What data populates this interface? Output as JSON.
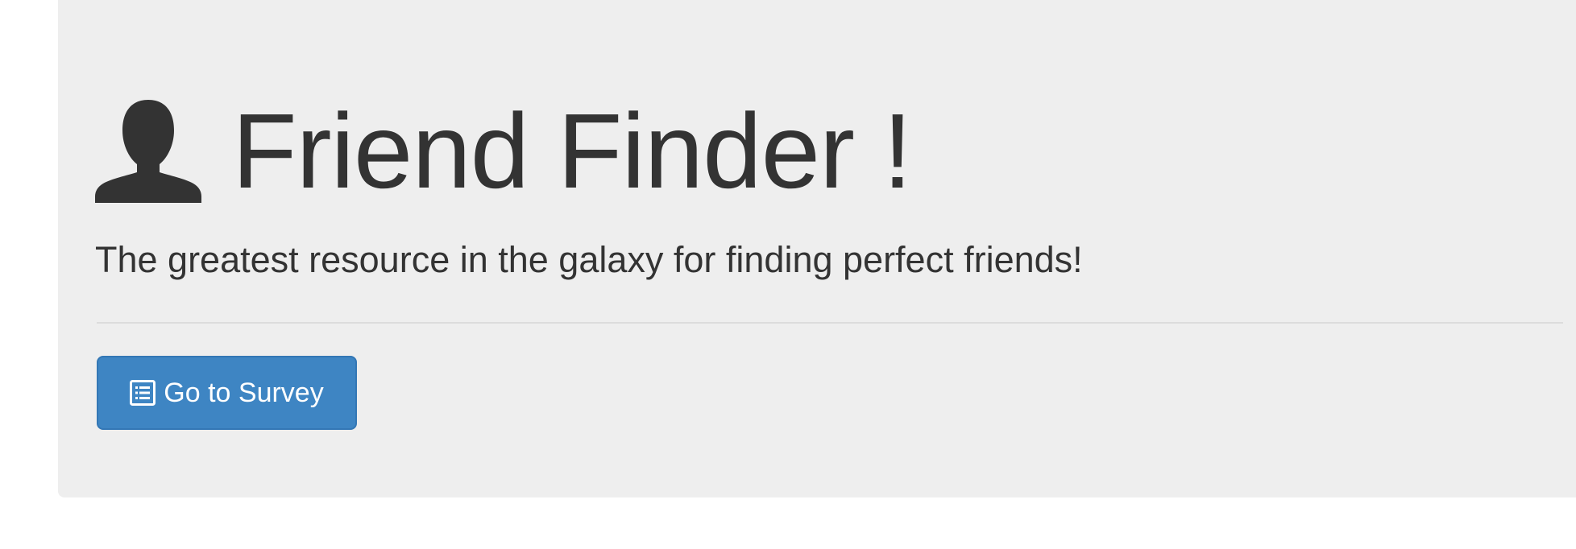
{
  "header": {
    "title": "Friend Finder !",
    "icon": "user-icon",
    "subtitle": "The greatest resource in the galaxy for finding perfect friends!"
  },
  "actions": {
    "survey_button": {
      "label": "Go to Survey",
      "icon": "list-alt-icon"
    }
  },
  "colors": {
    "jumbotron_bg": "#eeeeee",
    "text": "#333333",
    "button_primary": "#3e85c3"
  }
}
